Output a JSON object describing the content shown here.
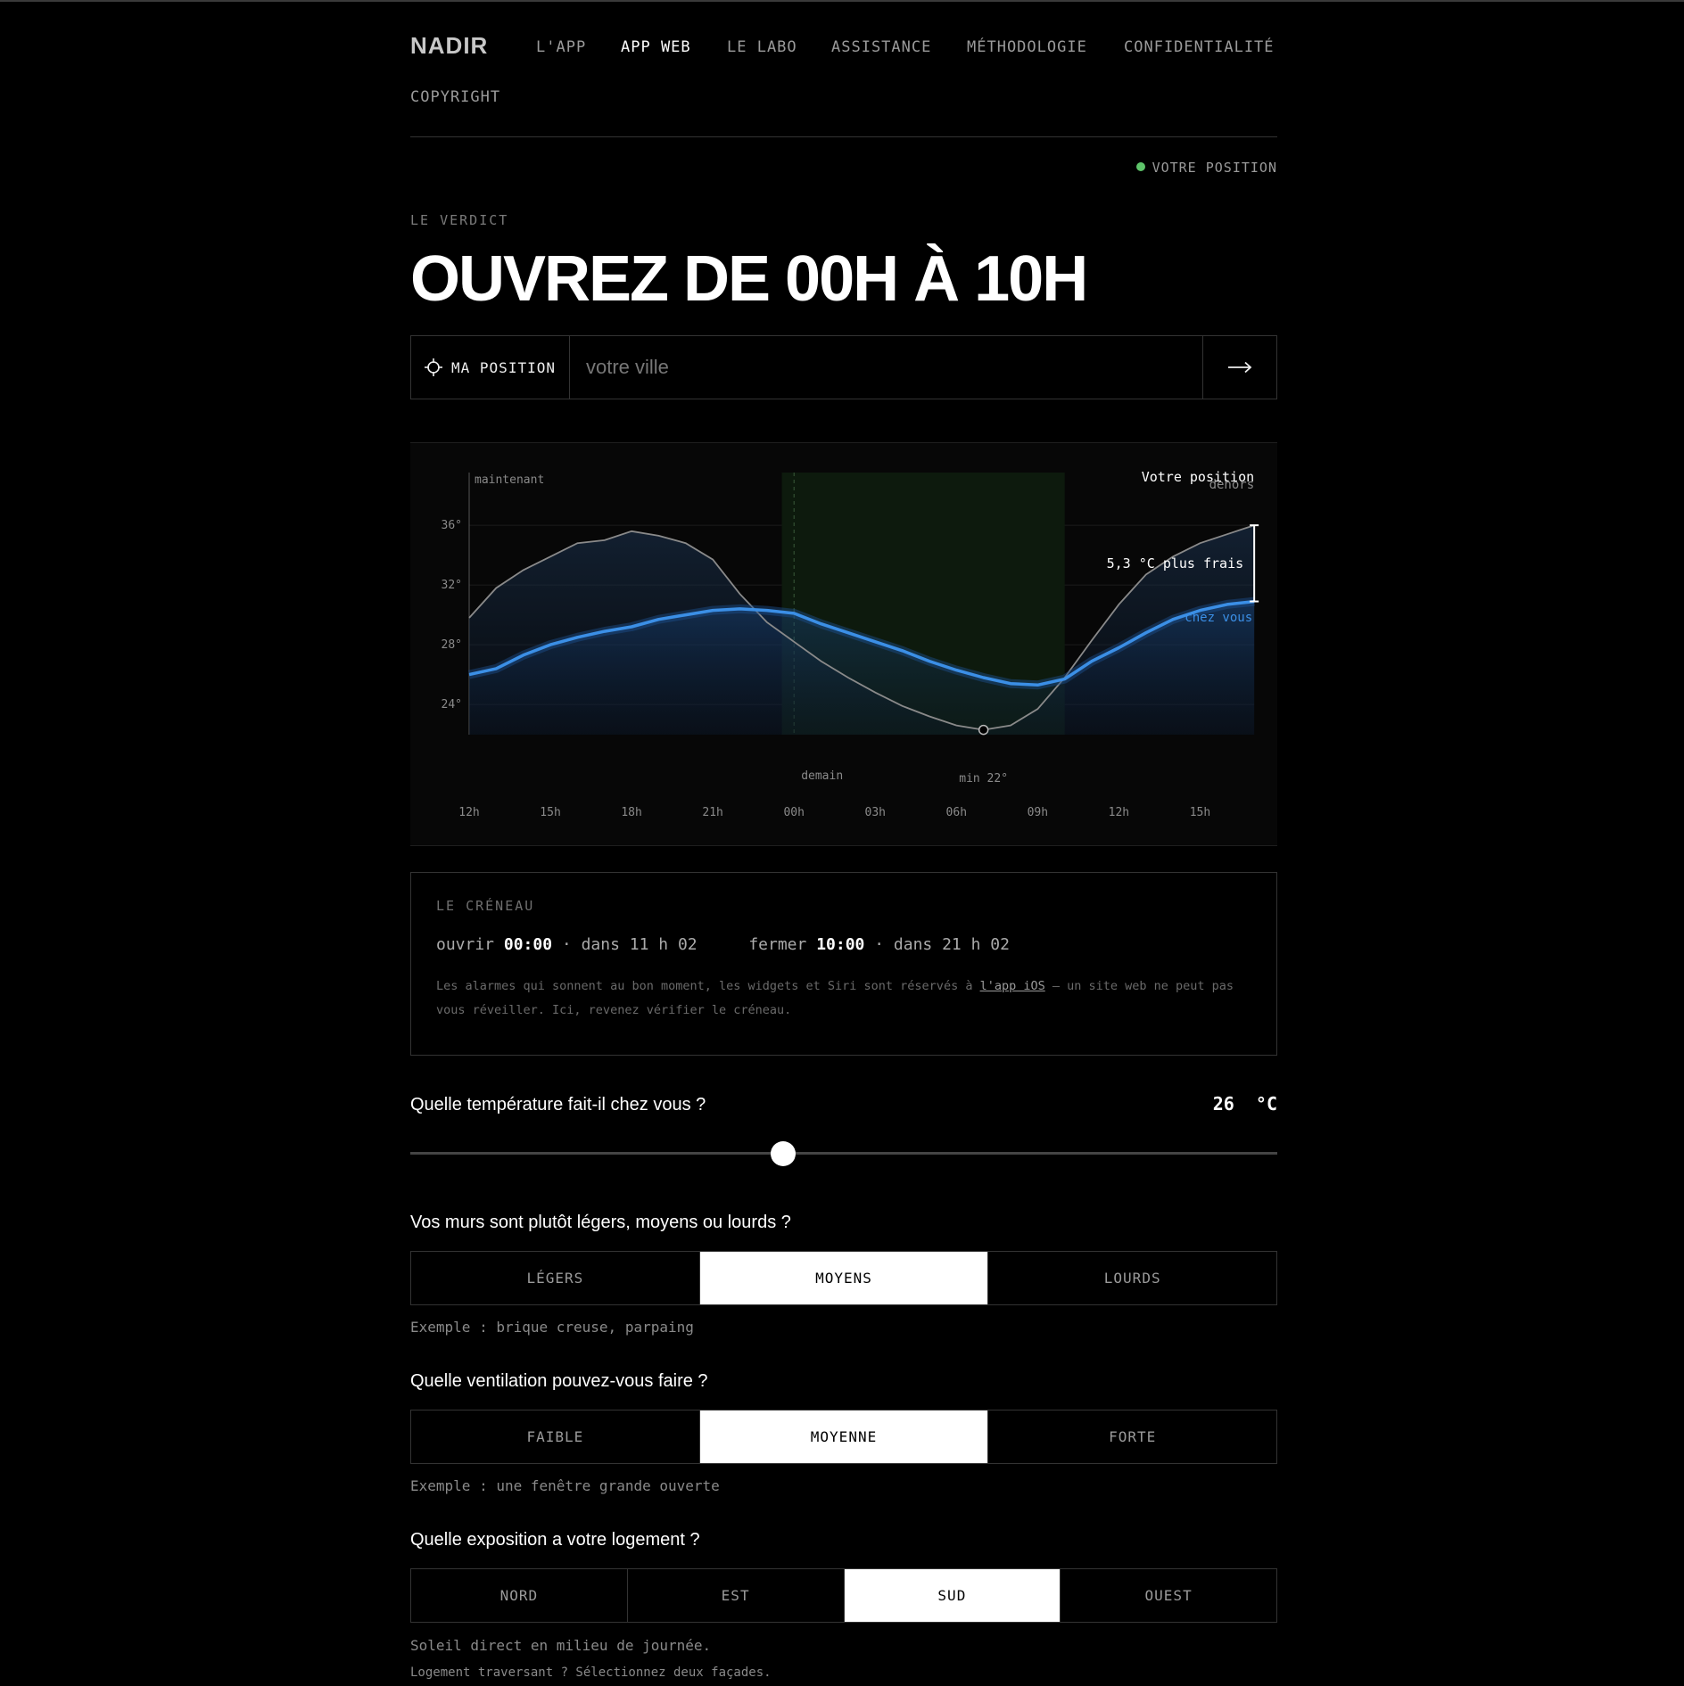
{
  "nav": {
    "brand": "NADIR",
    "links": [
      "L'APP",
      "APP WEB",
      "LE LABO",
      "ASSISTANCE",
      "MÉTHODOLOGIE",
      "CONFIDENTIALITÉ",
      "COPYRIGHT"
    ],
    "active": "APP WEB"
  },
  "status": {
    "label": "VOTRE POSITION",
    "color": "#5ec46a"
  },
  "verdict": {
    "eyebrow": "LE VERDICT",
    "headline": "OUVREZ DE 00H À 10H"
  },
  "search": {
    "position_button": "MA POSITION",
    "placeholder": "votre ville",
    "submit_icon": "arrow-right-icon"
  },
  "chart_data": {
    "type": "line",
    "x": [
      "12h",
      "13h",
      "14h",
      "15h",
      "16h",
      "17h",
      "18h",
      "19h",
      "20h",
      "21h",
      "22h",
      "23h",
      "00h",
      "01h",
      "02h",
      "03h",
      "04h",
      "05h",
      "06h",
      "07h",
      "08h",
      "09h",
      "10h",
      "11h",
      "12h",
      "13h",
      "14h",
      "15h",
      "16h",
      "17h"
    ],
    "xticks": [
      "12h",
      "15h",
      "18h",
      "21h",
      "00h",
      "03h",
      "06h",
      "09h",
      "12h",
      "15h"
    ],
    "yticks": [
      "24°",
      "28°",
      "32°",
      "36°"
    ],
    "ylim": [
      21.5,
      37.5
    ],
    "series": [
      {
        "name": "dehors",
        "color": "#8a8a8a",
        "values": [
          29.8,
          31.8,
          33.0,
          33.9,
          34.8,
          35.0,
          35.6,
          35.3,
          34.8,
          33.7,
          31.4,
          29.5,
          28.2,
          26.9,
          25.8,
          24.8,
          23.9,
          23.2,
          22.6,
          22.3,
          22.6,
          23.7,
          25.8,
          28.3,
          30.7,
          32.7,
          33.9,
          34.8,
          35.4,
          36.0
        ]
      },
      {
        "name": "chez vous",
        "color": "#3b8fe6",
        "values": [
          26.0,
          26.4,
          27.3,
          28.0,
          28.5,
          28.9,
          29.2,
          29.7,
          30.0,
          30.3,
          30.4,
          30.3,
          30.1,
          29.4,
          28.8,
          28.2,
          27.6,
          26.9,
          26.3,
          25.8,
          25.4,
          25.3,
          25.7,
          26.9,
          27.8,
          28.8,
          29.7,
          30.3,
          30.7,
          30.9
        ]
      }
    ],
    "highlight_window": [
      "00h",
      "10h"
    ],
    "highlight_color": "#0d1a0d",
    "labels": {
      "now": "maintenant",
      "tomorrow": "demain",
      "min": "min 22°",
      "location": "Votre position",
      "outside": "dehors",
      "inside": "chez vous",
      "delta": "5,3 °C plus frais"
    },
    "min_at": "07h"
  },
  "creneau": {
    "title": "LE CRÉNEAU",
    "open_label": "ouvrir",
    "open_time": "00:00",
    "open_rel": "· dans 11 h 02",
    "close_label": "fermer",
    "close_time": "10:00",
    "close_rel": "· dans 21 h 02",
    "note_before": "Les alarmes qui sonnent au bon moment, les widgets et Siri sont réservés à ",
    "note_link": "l'app iOS",
    "note_after": " — un site web ne peut pas vous réveiller. Ici, revenez vérifier le créneau."
  },
  "temperature": {
    "question": "Quelle température fait-il chez vous ?",
    "value": "26",
    "unit": "°C",
    "slider_fraction": 0.43
  },
  "walls": {
    "question": "Vos murs sont plutôt légers, moyens ou lourds ?",
    "options": [
      "LÉGERS",
      "MOYENS",
      "LOURDS"
    ],
    "selected": "MOYENS",
    "hint": "Exemple : brique creuse, parpaing"
  },
  "ventilation": {
    "question": "Quelle ventilation pouvez-vous faire ?",
    "options": [
      "FAIBLE",
      "MOYENNE",
      "FORTE"
    ],
    "selected": "MOYENNE",
    "hint": "Exemple : une fenêtre grande ouverte"
  },
  "exposure": {
    "question": "Quelle exposition a votre logement ?",
    "options": [
      "NORD",
      "EST",
      "SUD",
      "OUEST"
    ],
    "selected": "SUD",
    "hint": "Soleil direct en milieu de journée.",
    "hint2": "Logement traversant ? Sélectionnez deux façades."
  }
}
